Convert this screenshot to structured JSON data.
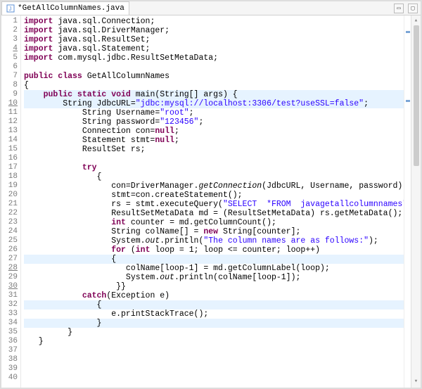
{
  "tab": {
    "filename": "*GetAllColumnNames.java"
  },
  "lines": [
    {
      "n": 1,
      "marked": false,
      "hl": false,
      "pre": "",
      "html": "<span class='kw'>import</span> java.sql.Connection;"
    },
    {
      "n": 2,
      "marked": false,
      "hl": false,
      "pre": "",
      "html": "<span class='kw'>import</span> java.sql.DriverManager;"
    },
    {
      "n": 3,
      "marked": false,
      "hl": false,
      "pre": "",
      "html": "<span class='kw'>import</span> java.sql.ResultSet;"
    },
    {
      "n": 4,
      "marked": true,
      "hl": false,
      "pre": "",
      "html": "<span class='kw'>import</span> java.sql.Statement;"
    },
    {
      "n": 5,
      "marked": false,
      "hl": false,
      "pre": "",
      "html": "<span class='kw'>import</span> com.mysql.jdbc.ResultSetMetaData;"
    },
    {
      "n": 6,
      "marked": false,
      "hl": false,
      "pre": "",
      "html": ""
    },
    {
      "n": 7,
      "marked": false,
      "hl": false,
      "pre": "",
      "html": "<span class='kw'>public class</span> GetAllColumnNames"
    },
    {
      "n": 8,
      "marked": false,
      "hl": false,
      "pre": "",
      "html": "{"
    },
    {
      "n": 9,
      "marked": false,
      "hl": true,
      "pre": "    ",
      "html": "<span class='kw'>public static void</span> main(String[] args) {"
    },
    {
      "n": 10,
      "marked": true,
      "hl": true,
      "pre": "        ",
      "html": "String JdbcURL=<span class='str'>\"jdbc:mysql://localhost:3306/test?useSSL=false\"</span>;"
    },
    {
      "n": 11,
      "marked": false,
      "hl": false,
      "pre": "            ",
      "html": "String Username=<span class='str'>\"root\"</span>;"
    },
    {
      "n": 12,
      "marked": false,
      "hl": false,
      "pre": "            ",
      "html": "String password=<span class='str'>\"123456\"</span>;"
    },
    {
      "n": 13,
      "marked": false,
      "hl": false,
      "pre": "            ",
      "html": "Connection con=<span class='kw'>null</span>;"
    },
    {
      "n": 14,
      "marked": false,
      "hl": false,
      "pre": "            ",
      "html": "Statement stmt=<span class='kw'>null</span>;"
    },
    {
      "n": 15,
      "marked": false,
      "hl": false,
      "pre": "            ",
      "html": "ResultSet rs;"
    },
    {
      "n": 16,
      "marked": false,
      "hl": false,
      "pre": "",
      "html": ""
    },
    {
      "n": 17,
      "marked": false,
      "hl": false,
      "pre": "            ",
      "html": "<span class='kw'>try</span>"
    },
    {
      "n": 18,
      "marked": false,
      "hl": false,
      "pre": "               ",
      "html": "{"
    },
    {
      "n": 19,
      "marked": false,
      "hl": false,
      "pre": "                  ",
      "html": "con=DriverManager.<span class='it'>getConnection</span>(JdbcURL, Username, password);"
    },
    {
      "n": 20,
      "marked": false,
      "hl": false,
      "pre": "                  ",
      "html": "stmt=con.createStatement();"
    },
    {
      "n": 21,
      "marked": false,
      "hl": false,
      "pre": "                  ",
      "html": "rs = stmt.executeQuery(<span class='str'>\"SELECT  *FROM  javagetallcolumnnames\"</span>);"
    },
    {
      "n": 22,
      "marked": false,
      "hl": false,
      "pre": "                  ",
      "html": "ResultSetMetaData md = (ResultSetMetaData) rs.getMetaData();"
    },
    {
      "n": 23,
      "marked": false,
      "hl": false,
      "pre": "                  ",
      "html": "<span class='kw'>int</span> counter = md.getColumnCount();"
    },
    {
      "n": 24,
      "marked": false,
      "hl": false,
      "pre": "                  ",
      "html": "String colName[] = <span class='kw'>new</span> String[counter];"
    },
    {
      "n": 25,
      "marked": false,
      "hl": false,
      "pre": "                  ",
      "html": "System.<span class='it'>out</span>.println(<span class='str'>\"The column names are as follows:\"</span>);"
    },
    {
      "n": 26,
      "marked": false,
      "hl": false,
      "pre": "                  ",
      "html": "<span class='kw'>for</span> (<span class='kw'>int</span> loop = 1; loop &lt;= counter; loop++)"
    },
    {
      "n": 27,
      "marked": false,
      "hl": true,
      "pre": "                  ",
      "html": "{"
    },
    {
      "n": 28,
      "marked": true,
      "hl": false,
      "pre": "                     ",
      "html": "colName[loop-1] = md.getColumnLabel(loop);"
    },
    {
      "n": 29,
      "marked": false,
      "hl": false,
      "pre": "                     ",
      "html": "System.<span class='it'>out</span>.println(colName[loop-1]);"
    },
    {
      "n": 30,
      "marked": true,
      "hl": false,
      "pre": "                   ",
      "html": "}}"
    },
    {
      "n": 31,
      "marked": false,
      "hl": false,
      "pre": "            ",
      "html": "<span class='kw'>catch</span>(Exception e)"
    },
    {
      "n": 32,
      "marked": false,
      "hl": true,
      "pre": "               ",
      "html": "{"
    },
    {
      "n": 33,
      "marked": false,
      "hl": false,
      "pre": "                  ",
      "html": "e.printStackTrace();"
    },
    {
      "n": 34,
      "marked": false,
      "hl": true,
      "pre": "               ",
      "html": "}"
    },
    {
      "n": 35,
      "marked": false,
      "hl": false,
      "pre": "         ",
      "html": "}"
    },
    {
      "n": 36,
      "marked": false,
      "hl": false,
      "pre": "   ",
      "html": "}"
    },
    {
      "n": 37,
      "marked": false,
      "hl": false,
      "pre": "",
      "html": ""
    },
    {
      "n": 38,
      "marked": false,
      "hl": false,
      "pre": "",
      "html": ""
    },
    {
      "n": 39,
      "marked": false,
      "hl": false,
      "pre": "",
      "html": ""
    },
    {
      "n": 40,
      "marked": false,
      "hl": false,
      "pre": "",
      "html": ""
    }
  ]
}
